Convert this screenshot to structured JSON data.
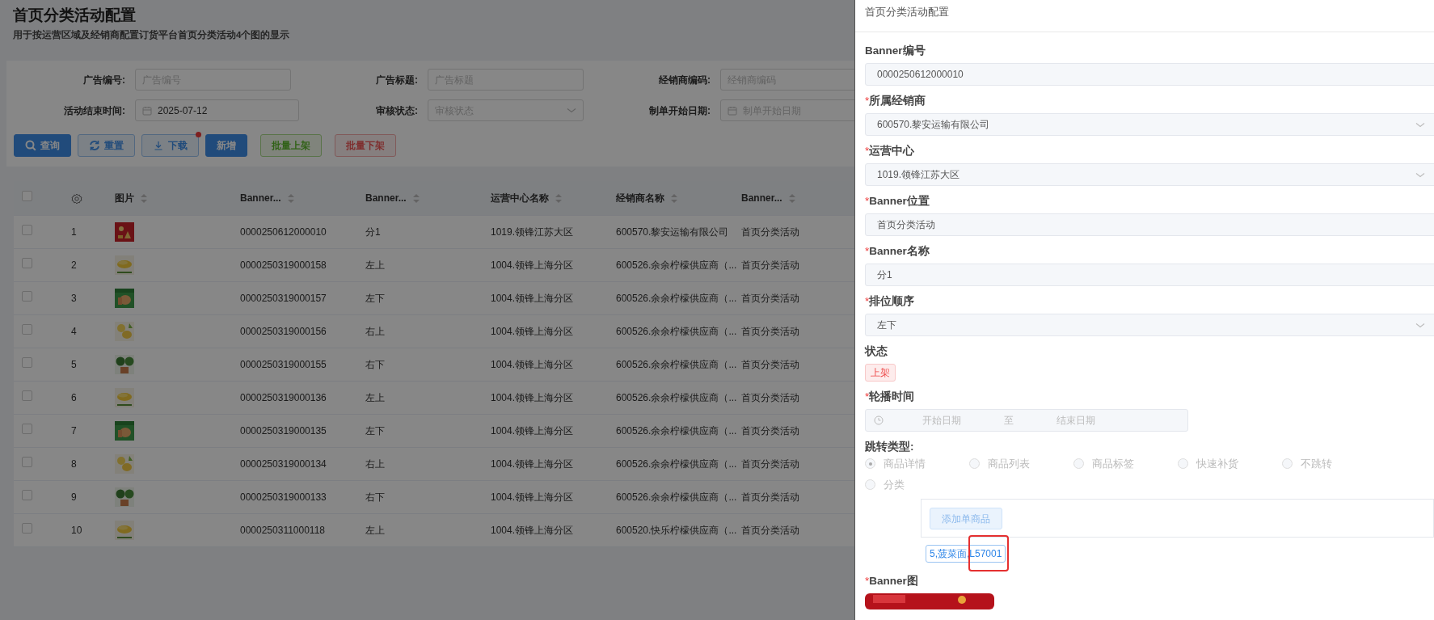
{
  "page": {
    "title": "首页分类活动配置",
    "subtitle": "用于按运营区域及经销商配置订货平台首页分类活动4个图的显示"
  },
  "filters": [
    {
      "label": "广告编号:",
      "kind": "text",
      "placeholder": "广告编号"
    },
    {
      "label": "广告标题:",
      "kind": "text",
      "placeholder": "广告标题"
    },
    {
      "label": "经销商编码:",
      "kind": "text",
      "placeholder": "经销商编码"
    },
    {
      "label": "活动结束时间:",
      "kind": "date",
      "value": "2025-07-12"
    },
    {
      "label": "审核状态:",
      "kind": "select",
      "placeholder": "审核状态"
    },
    {
      "label": "制单开始日期:",
      "kind": "date",
      "placeholder": "制单开始日期"
    }
  ],
  "buttons": [
    {
      "label": "查询",
      "kind": "query"
    },
    {
      "label": "重置",
      "kind": "reset"
    },
    {
      "label": "下载",
      "kind": "download",
      "dot": true
    },
    {
      "label": "新增",
      "kind": "add"
    },
    {
      "label": "批量上架",
      "kind": "batch_on"
    },
    {
      "label": "批量下架",
      "kind": "batch_off"
    }
  ],
  "table": {
    "all_checked": false,
    "columns": [
      {
        "label": "图片"
      },
      {
        "label": "Banner..."
      },
      {
        "label": "Banner..."
      },
      {
        "label": "运营中心名称"
      },
      {
        "label": "经销商名称"
      },
      {
        "label": "Banner..."
      }
    ],
    "rows": [
      {
        "checked": false,
        "index": "1",
        "code": "0000250612000010",
        "name": "分1",
        "center": "1019.领锋江苏大区",
        "dealer": "600570.黎安运输有限公司",
        "position": "首页分类活动"
      },
      {
        "checked": false,
        "index": "2",
        "code": "0000250319000158",
        "name": "左上",
        "center": "1004.领锋上海分区",
        "dealer": "600526.余余柠檬供应商（...",
        "position": "首页分类活动"
      },
      {
        "checked": false,
        "index": "3",
        "code": "0000250319000157",
        "name": "左下",
        "center": "1004.领锋上海分区",
        "dealer": "600526.余余柠檬供应商（...",
        "position": "首页分类活动"
      },
      {
        "checked": false,
        "index": "4",
        "code": "0000250319000156",
        "name": "右上",
        "center": "1004.领锋上海分区",
        "dealer": "600526.余余柠檬供应商（...",
        "position": "首页分类活动"
      },
      {
        "checked": false,
        "index": "5",
        "code": "0000250319000155",
        "name": "右下",
        "center": "1004.领锋上海分区",
        "dealer": "600526.余余柠檬供应商（...",
        "position": "首页分类活动"
      },
      {
        "checked": false,
        "index": "6",
        "code": "0000250319000136",
        "name": "左上",
        "center": "1004.领锋上海分区",
        "dealer": "600526.余余柠檬供应商（...",
        "position": "首页分类活动"
      },
      {
        "checked": false,
        "index": "7",
        "code": "0000250319000135",
        "name": "左下",
        "center": "1004.领锋上海分区",
        "dealer": "600526.余余柠檬供应商（...",
        "position": "首页分类活动"
      },
      {
        "checked": false,
        "index": "8",
        "code": "0000250319000134",
        "name": "右上",
        "center": "1004.领锋上海分区",
        "dealer": "600526.余余柠檬供应商（...",
        "position": "首页分类活动"
      },
      {
        "checked": false,
        "index": "9",
        "code": "0000250319000133",
        "name": "右下",
        "center": "1004.领锋上海分区",
        "dealer": "600526.余余柠檬供应商（...",
        "position": "首页分类活动"
      },
      {
        "checked": false,
        "index": "10",
        "code": "0000250311000118",
        "name": "左上",
        "center": "1004.领锋上海分区",
        "dealer": "600520.快乐柠檬供应商（...",
        "position": "首页分类活动"
      }
    ]
  },
  "drawer": {
    "title": "首页分类活动配置",
    "fields": [
      {
        "kind": "text",
        "label": "Banner编号",
        "value": "0000250612000010"
      },
      {
        "kind": "select",
        "mark": "*",
        "label": "所属经销商",
        "value": "600570.黎安运输有限公司"
      },
      {
        "kind": "select",
        "mark": "*",
        "label": "运营中心",
        "value": "1019.领锋江苏大区"
      },
      {
        "kind": "text",
        "mark": "*",
        "label": "Banner位置",
        "value": "首页分类活动"
      },
      {
        "kind": "text",
        "mark": "*",
        "label": "Banner名称",
        "value": "分1"
      },
      {
        "kind": "select",
        "mark": "*",
        "label": "排位顺序",
        "value": "左下"
      },
      {
        "kind": "tag",
        "label": "状态",
        "value": "上架"
      },
      {
        "kind": "daterange",
        "mark": "*",
        "label": "轮播时间",
        "start_placeholder": "开始日期",
        "separator": "至",
        "end_placeholder": "结束日期"
      },
      {
        "kind": "radios",
        "label": "跳转类型:",
        "disabled": true,
        "options": [
          {
            "label": "商品详情",
            "selected": true
          },
          {
            "label": "商品列表",
            "selected": false
          },
          {
            "label": "商品标签",
            "selected": false
          },
          {
            "label": "快速补货",
            "selected": false
          },
          {
            "label": "不跳转",
            "selected": false
          },
          {
            "label": "分类",
            "selected": false
          }
        ],
        "add_button": "添加单商品",
        "product_tag": "5,菠菜面,L57001",
        "highlighted": true
      },
      {
        "mark": "*",
        "label": "Banner图"
      }
    ]
  }
}
